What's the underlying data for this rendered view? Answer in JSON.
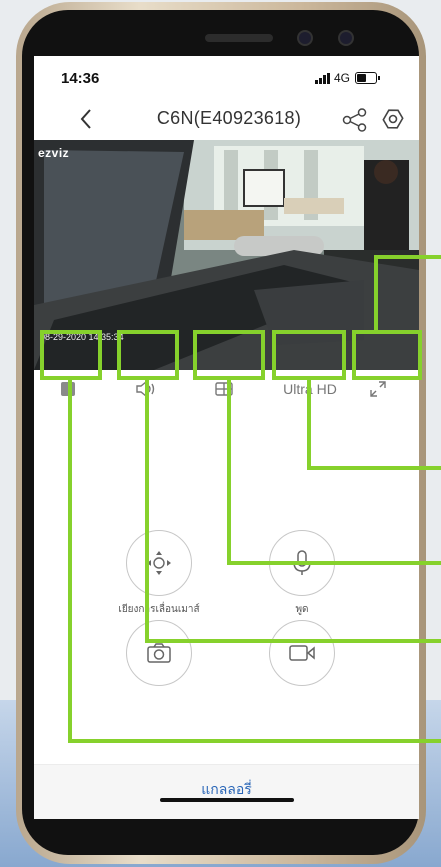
{
  "status_bar": {
    "time": "14:36",
    "network": "4G"
  },
  "header": {
    "title": "C6N(E40923618)"
  },
  "video": {
    "brand": "ezviz",
    "timestamp": "08-29-2020 14:35:34"
  },
  "controls": {
    "quality_label": "Ultra HD"
  },
  "actions": {
    "ptz_label": "เยียงการเลื่อนเมาส์",
    "talk_label": "พูด"
  },
  "gallery": {
    "label": "แกลลอรี่"
  },
  "colors": {
    "highlight": "#86d12c",
    "accent": "#2b67b8"
  }
}
